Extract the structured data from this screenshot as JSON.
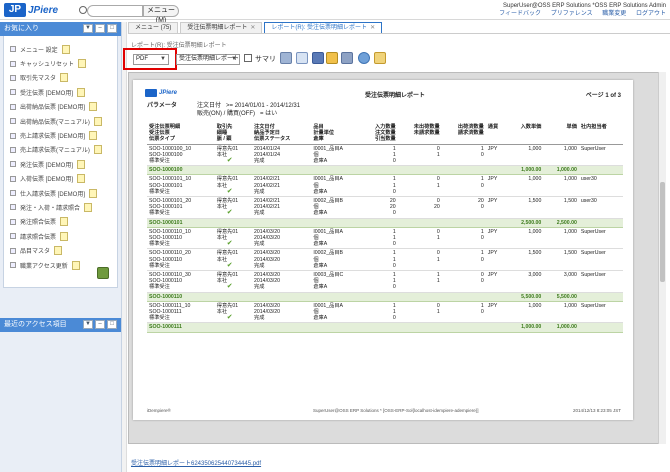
{
  "header": {
    "logo_mark": "JP",
    "logo_text": "JPiere",
    "menu_button": "メニュー(M)",
    "user": "SuperUser@OSS ERP Solutions *OSS ERP Solutions Admin",
    "links": [
      "フィードバック",
      "プリファレンス",
      "職業変更",
      "ログアウト"
    ]
  },
  "favorites": {
    "title": "お気に入り",
    "items": [
      "メニュー 設定",
      "キャッシュリセット",
      "取引先マスタ",
      "受注伝票 [DEMO用]",
      "出荷納品伝票 [DEMO用]",
      "出荷納品伝票(マニュアル)",
      "売上請求伝票 [DEMO用]",
      "売上請求伝票(マニュアル)",
      "発注伝票 [DEMO用]",
      "入荷伝票 [DEMO用]",
      "仕入請求伝票 [DEMO用]",
      "発注・入荷・請求照合",
      "発注照合伝票",
      "請求照合伝票",
      "品目マスタ",
      "職業アクセス更新"
    ]
  },
  "recent": {
    "title": "最近のアクセス項目"
  },
  "tabs": [
    {
      "label": "メニュー (75)"
    },
    {
      "label": "受注伝票明細レポート"
    },
    {
      "label": "レポート(R): 受注伝票明細レポート"
    }
  ],
  "breadcrumb": "レポート(R): 受注伝票明細レポート",
  "toolbar": {
    "format": "PDF",
    "print_format": "受注伝票明細レポート",
    "summary_label": "サマリ"
  },
  "report": {
    "logo_text": "JPiere",
    "title": "受注伝票明細レポート",
    "page": "ページ 1 of 3",
    "param_label": "パラメータ",
    "param_date_label": "注文日付",
    "param_date_value": ">=  2014/01/01 - 2014/12/31",
    "param_sales_label": "販売(ON) / 購買(OFF)",
    "param_sales_value": "=  はい",
    "headers": [
      "受注伝票明細\n受注伝票\n伝票タイプ",
      "取引先\n細睡\n脈 / 顕",
      "注文日付\n納品予定日\n伝票ステータス",
      "品目\n計量単位\n倉庫",
      "入力数量\n注文数量\n引当数量",
      "未出荷数量\n未請求数量",
      "出荷済数量\n請求済数量",
      "通貨",
      "入数単価",
      "単価",
      "社内担当者"
    ],
    "rows": [
      {
        "type": "line",
        "c1": "SOO-1000100_10\nSOO-1000100\n標準受注",
        "c2": "得意先01\n本社",
        "check": true,
        "c3": "2014/01/24\n2014/01/24\n完成",
        "c4": "I0001_品目A\n個\n倉庫A",
        "c5": "1\n1\n0",
        "c6": "0\n1",
        "c7": "1\n0",
        "c8": "JPY",
        "c9": "1,000",
        "c10": "1,000",
        "c11": "SuperUser"
      },
      {
        "type": "sub",
        "label": "SOO-1000100",
        "v1": "1,000.00",
        "v2": "1,000.00"
      },
      {
        "type": "line",
        "c1": "SOO-1000101_10\nSOO-1000101\n標準受注",
        "c2": "得意先01\n本社",
        "check": true,
        "c3": "2014/02/21\n2014/02/21\n完成",
        "c4": "I0001_品目A\n個\n倉庫A",
        "c5": "1\n1\n0",
        "c6": "0\n1",
        "c7": "1\n0",
        "c8": "JPY",
        "c9": "1,000",
        "c10": "1,000",
        "c11": "user30"
      },
      {
        "type": "line",
        "c1": "SOO-1000101_20\nSOO-1000101\n標準受注",
        "c2": "得意先01\n本社",
        "check": true,
        "c3": "2014/02/21\n2014/02/21\n完成",
        "c4": "I0002_品目B\n個\n倉庫A",
        "c5": "20\n20\n0",
        "c6": "0\n20",
        "c7": "20\n0",
        "c8": "JPY",
        "c9": "1,500",
        "c10": "1,500",
        "c11": "user30"
      },
      {
        "type": "sub",
        "label": "SOO-1000101",
        "v1": "2,500.00",
        "v2": "2,500.00"
      },
      {
        "type": "line",
        "c1": "SOO-1000110_10\nSOO-1000110\n標準受注",
        "c2": "得意先01\n本社",
        "check": true,
        "c3": "2014/03/20\n2014/03/20\n完成",
        "c4": "I0001_品目A\n個\n倉庫A",
        "c5": "1\n1\n0",
        "c6": "0\n1",
        "c7": "1\n0",
        "c8": "JPY",
        "c9": "1,000",
        "c10": "1,000",
        "c11": "SuperUser"
      },
      {
        "type": "line",
        "c1": "SOO-1000110_20\nSOO-1000110\n標準受注",
        "c2": "得意先01\n本社",
        "check": true,
        "c3": "2014/03/20\n2014/03/20\n完成",
        "c4": "I0002_品目B\n個\n倉庫A",
        "c5": "1\n1\n0",
        "c6": "0\n1",
        "c7": "1\n0",
        "c8": "JPY",
        "c9": "1,500",
        "c10": "1,500",
        "c11": "SuperUser"
      },
      {
        "type": "line",
        "c1": "SOO-1000110_30\nSOO-1000110\n標準受注",
        "c2": "得意先01\n本社",
        "check": true,
        "c3": "2014/03/20\n2014/03/20\n完成",
        "c4": "I0003_品目C\n個\n倉庫A",
        "c5": "1\n1\n0",
        "c6": "1\n1",
        "c7": "0\n0",
        "c8": "JPY",
        "c9": "3,000",
        "c10": "3,000",
        "c11": "SuperUser"
      },
      {
        "type": "sub",
        "label": "SOO-1000110",
        "v1": "5,500.00",
        "v2": "5,500.00"
      },
      {
        "type": "line",
        "c1": "SOO-1000111_10\nSOO-1000111\n標準受注",
        "c2": "得意先01\n本社",
        "check": true,
        "c3": "2014/03/20\n2014/03/20\n完成",
        "c4": "I0001_品目A\n個\n倉庫A",
        "c5": "1\n1\n0",
        "c6": "0\n1",
        "c7": "1\n0",
        "c8": "JPY",
        "c9": "1,000",
        "c10": "1,000",
        "c11": "SuperUser"
      },
      {
        "type": "sub",
        "label": "SOO-1000111",
        "v1": "1,000.00",
        "v2": "1,000.00"
      }
    ],
    "footer_left": "iDempiere®",
    "footer_center": "SuperUser@OSS ERP Solutions * [OSS-ERP-Sol{localhost-idempiere-adempiere}]",
    "footer_right": "2014/12/13 8:23:05 JST"
  },
  "bottom_link": "受注伝票明細レポート624350625440734445.pdf"
}
